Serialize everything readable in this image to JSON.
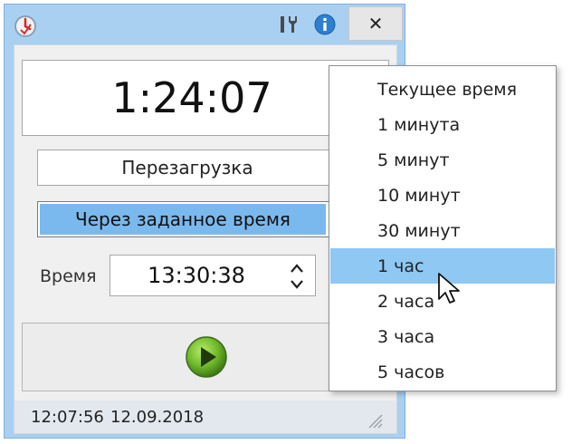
{
  "window": {
    "icons": {
      "app": "shutdown-timer-app-icon",
      "tools": "tools-icon",
      "info": "info-icon",
      "close": "close-icon"
    },
    "close_glyph": "✕"
  },
  "clock": {
    "time": "1:24:07"
  },
  "action": {
    "value": "Перезагрузка"
  },
  "mode": {
    "value": "Через заданное время"
  },
  "time_field": {
    "label": "Время",
    "value": "13:30:38"
  },
  "start": {
    "icon": "play-icon"
  },
  "status": {
    "time": "12:07:56",
    "date": "12.09.2018"
  },
  "dropdown": {
    "items": [
      {
        "label": "Текущее время",
        "selected": false
      },
      {
        "label": "1 минута",
        "selected": false
      },
      {
        "label": "5 минут",
        "selected": false
      },
      {
        "label": "10 минут",
        "selected": false
      },
      {
        "label": "30 минут",
        "selected": false
      },
      {
        "label": "1 час",
        "selected": true
      },
      {
        "label": "2 часа",
        "selected": false
      },
      {
        "label": "3 часа",
        "selected": false
      },
      {
        "label": "5 часов",
        "selected": false
      }
    ]
  },
  "colors": {
    "selection": "#8ec8f3",
    "mode_highlight": "#7ab9ee",
    "frame": "#a9d0f1",
    "play": "#6fb82a"
  }
}
